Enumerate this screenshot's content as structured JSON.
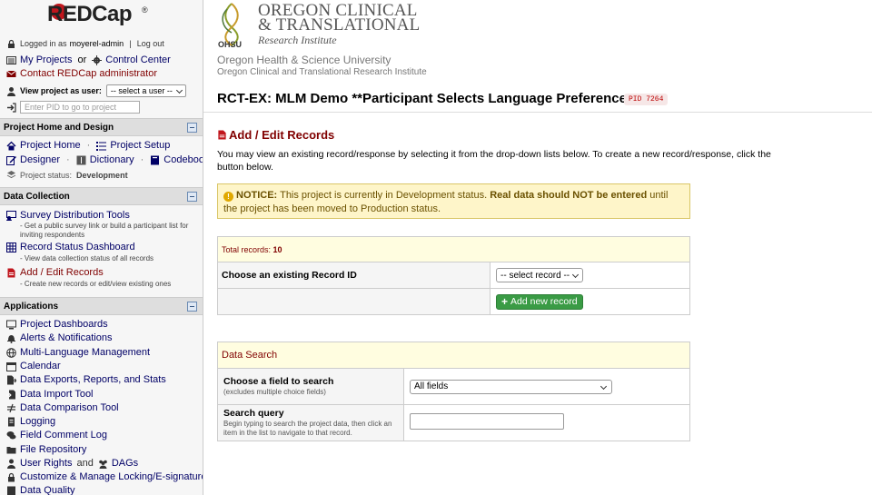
{
  "sidebar": {
    "logo": {
      "text": "REDCap",
      "reg": "®"
    },
    "logged_in": "Logged in as",
    "username": "moyerel-admin",
    "sep": "|",
    "logout": "Log out",
    "my_projects": "My Projects",
    "or": "or",
    "control_center": "Control Center",
    "contact_admin": "Contact REDCap administrator",
    "view_as_user_label": "View project as user:",
    "view_as_user_value": "-- select a user --",
    "pid_placeholder": "Enter PID to go to project",
    "sections": {
      "home": {
        "title": "Project Home and Design",
        "project_home": "Project Home",
        "project_setup": "Project Setup",
        "designer": "Designer",
        "dictionary": "Dictionary",
        "codebook": "Codebook",
        "status_label": "Project status:",
        "status_value": "Development"
      },
      "data_collection": {
        "title": "Data Collection",
        "items": [
          {
            "label": "Survey Distribution Tools",
            "desc": "- Get a public survey link or build a participant list for inviting respondents"
          },
          {
            "label": "Record Status Dashboard",
            "desc": "- View data collection status of all records"
          },
          {
            "label": "Add / Edit Records",
            "desc": "- Create new records or edit/view existing ones"
          }
        ]
      },
      "applications": {
        "title": "Applications",
        "items": [
          "Project Dashboards",
          "Alerts & Notifications",
          "Multi-Language Management",
          "Calendar",
          "Data Exports, Reports, and Stats",
          "Data Import Tool",
          "Data Comparison Tool",
          "Logging",
          "Field Comment Log",
          "File Repository",
          "User Rights",
          "and",
          "DAGs",
          "Customize & Manage Locking/E-signatures",
          "Data Quality"
        ]
      }
    }
  },
  "header": {
    "inst_line1": "OREGON CLINICAL",
    "inst_line2": "& TRANSLATIONAL",
    "inst_line3": "Research Institute",
    "ohsu": "OHSU",
    "university": "Oregon Health & Science University",
    "institute": "Oregon Clinical and Translational Research Institute"
  },
  "project": {
    "title": "RCT-EX: MLM Demo **Participant Selects Language Preference**",
    "pid": "PID 7264"
  },
  "page": {
    "heading": "Add / Edit Records",
    "description": "You may view an existing record/response by selecting it from the drop-down lists below. To create a new record/response, click the button below.",
    "notice_label": "NOTICE:",
    "notice_text1": "This project is currently in Development status.",
    "notice_bold": "Real data should NOT be entered",
    "notice_text2": "until the project has been moved to Production status."
  },
  "records": {
    "total_label": "Total records:",
    "total_value": "10",
    "choose_label": "Choose an existing Record ID",
    "select_value": "-- select record --",
    "add_button": "Add new record"
  },
  "search": {
    "title": "Data Search",
    "field_label": "Choose a field to search",
    "field_hint": "(excludes multiple choice fields)",
    "field_value": "All fields",
    "query_label": "Search query",
    "query_hint": "Begin typing to search the project data, then click an item in the list to navigate to that record."
  },
  "colors": {
    "brand_red": "#800000",
    "nav_blue": "#000066",
    "notice_bg": "#fef5c9",
    "add_green": "#3a9b45"
  }
}
